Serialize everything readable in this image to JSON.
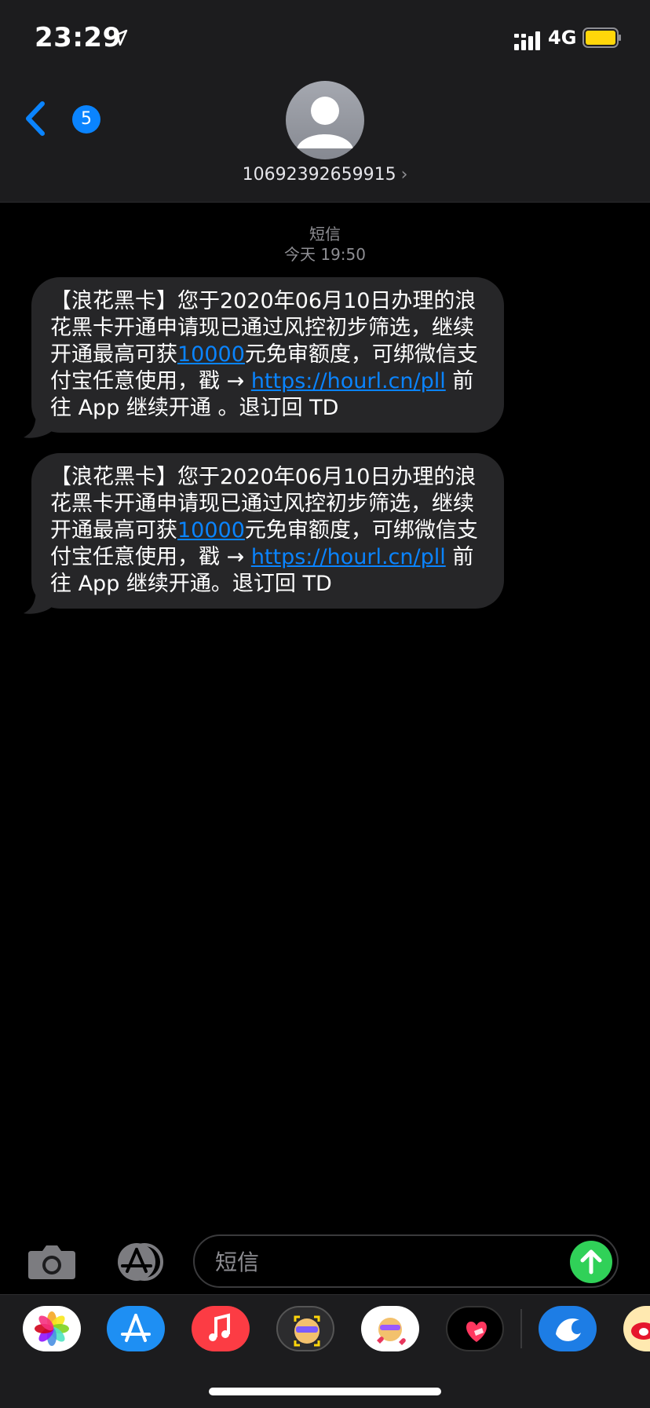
{
  "status_bar": {
    "time": "23:29",
    "network": "4G"
  },
  "header": {
    "back_badge": "5",
    "contact_number": "10692392659915",
    "contact_chevron": "›"
  },
  "thread": {
    "service_label": "短信",
    "timestamp": "今天 19:50",
    "messages": [
      {
        "text_1": "【浪花黑卡】您于2020年06月10日办理的浪花黑卡开通申请现已通过风控初步筛选，继续开通最高可获",
        "amount_link": "10000",
        "text_2": "元免审额度，可绑微信支付宝任意使用，戳 →",
        "url": "https://hourl.cn/pll",
        "text_3": "前往 App 继续开通 。退订回 TD"
      },
      {
        "text_1": "【浪花黑卡】您于2020年06月10日办理的浪花黑卡开通申请现已通过风控初步筛选，继续开通最高可获",
        "amount_link": "10000",
        "text_2": "元免审额度，可绑微信支付宝任意使用，戳 →",
        "url": "https://hourl.cn/pll",
        "text_3": "前往 App 继续开通。退订回 TD"
      }
    ]
  },
  "input": {
    "placeholder": "短信"
  },
  "colors": {
    "accent": "#0a84ff",
    "send": "#30d158",
    "bubble": "#262628",
    "bar": "#1c1c1e"
  },
  "app_drawer": {
    "apps": [
      "photos-icon",
      "app-store-icon",
      "music-icon",
      "memoji-icon",
      "memoji-hearts-icon",
      "digital-touch-icon",
      "ctrip-icon",
      "weibo-icon"
    ]
  }
}
